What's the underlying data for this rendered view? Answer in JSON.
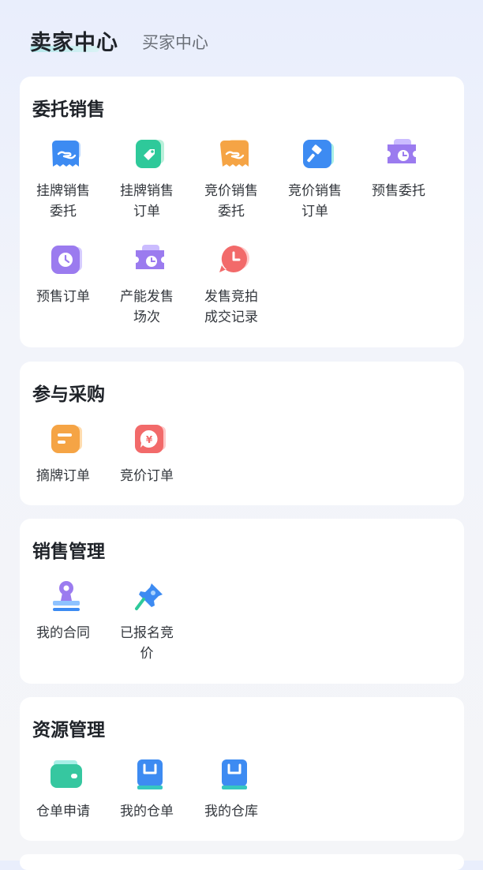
{
  "header": {
    "active_tab": "卖家中心",
    "inactive_tab": "买家中心"
  },
  "sections": [
    {
      "title": "委托销售",
      "items": [
        {
          "label": "挂牌销售\n委托",
          "icon": "listing-hand-icon"
        },
        {
          "label": "挂牌销售\n订单",
          "icon": "price-tag-icon"
        },
        {
          "label": "竞价销售\n委托",
          "icon": "bid-hand-icon"
        },
        {
          "label": "竞价销售\n订单",
          "icon": "auction-hammer-icon"
        },
        {
          "label": "预售委托",
          "icon": "ticket-clock-icon"
        },
        {
          "label": "预售订单",
          "icon": "clock-icon"
        },
        {
          "label": "产能发售\n场次",
          "icon": "ticket-clock-icon"
        },
        {
          "label": "发售竞拍\n成交记录",
          "icon": "clock-bubble-icon"
        }
      ]
    },
    {
      "title": "参与采购",
      "items": [
        {
          "label": "摘牌订单",
          "icon": "document-card-icon"
        },
        {
          "label": "竞价订单",
          "icon": "yen-bubble-icon"
        }
      ]
    },
    {
      "title": "销售管理",
      "items": [
        {
          "label": "我的合同",
          "icon": "stamp-icon"
        },
        {
          "label": "已报名竞\n价",
          "icon": "pushpin-icon"
        }
      ]
    },
    {
      "title": "资源管理",
      "items": [
        {
          "label": "仓单申请",
          "icon": "wallet-icon"
        },
        {
          "label": "我的仓单",
          "icon": "warehouse-book-icon"
        },
        {
          "label": "我的仓库",
          "icon": "warehouse-book-icon"
        }
      ]
    }
  ],
  "colors": {
    "blue": "#3d8bf2",
    "green": "#2ec99a",
    "orange": "#f5a445",
    "purple": "#9b7bef",
    "red": "#f26a6a",
    "cyan": "#36c7c0"
  }
}
